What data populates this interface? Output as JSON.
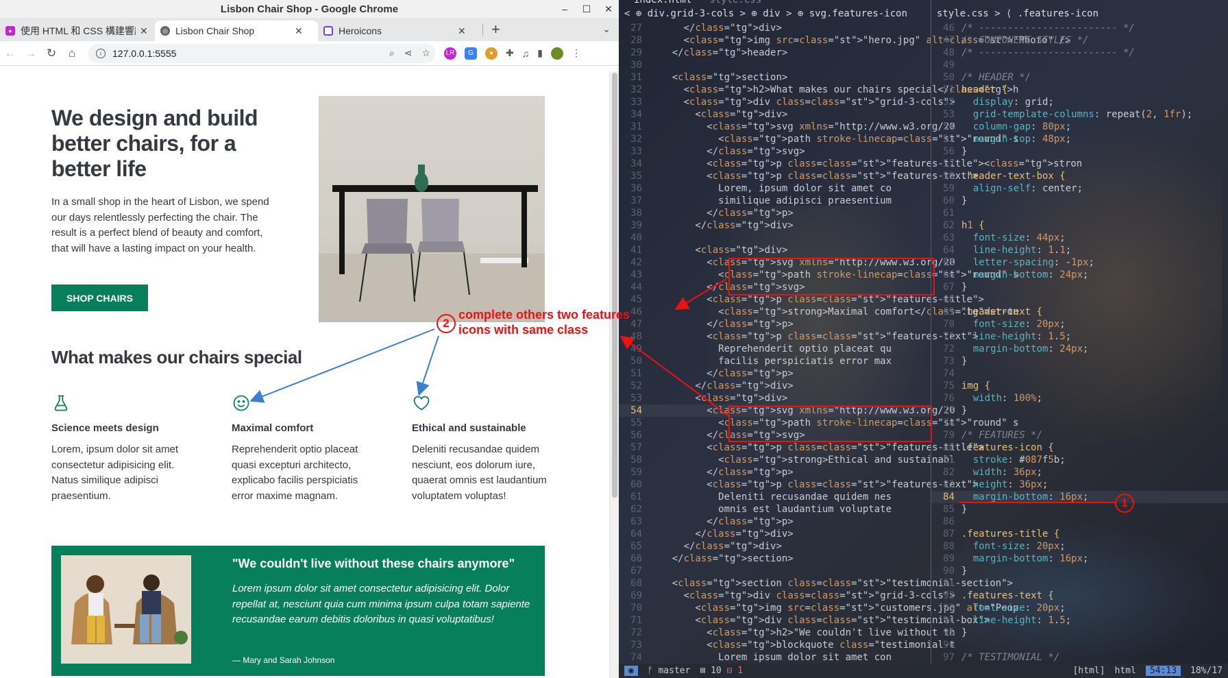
{
  "browser": {
    "window_title": "Lisbon Chair Shop - Google Chrome",
    "tabs": [
      {
        "label": "使用 HTML 和 CSS 構建響應",
        "active": false
      },
      {
        "label": "Lisbon Chair Shop",
        "active": true
      },
      {
        "label": "Heroicons",
        "active": false
      }
    ],
    "url": "127.0.0.1:5555"
  },
  "page": {
    "hero_title": "We design and build better chairs, for a better life",
    "hero_text": "In a small shop in the heart of Lisbon, we spend our days relentlessly perfecting the chair. The result is a perfect blend of beauty and comfort, that will have a lasting impact on your health.",
    "shop_button": "SHOP CHAIRS",
    "section_title": "What makes our chairs special",
    "features": [
      {
        "icon": "beaker-icon",
        "title": "Science meets design",
        "text": "Lorem, ipsum dolor sit amet consectetur adipisicing elit. Natus similique adipisci praesentium."
      },
      {
        "icon": "face-smile-icon",
        "title": "Maximal comfort",
        "text": "Reprehenderit optio placeat quasi excepturi architecto, explicabo facilis perspiciatis error maxime magnam."
      },
      {
        "icon": "heart-icon",
        "title": "Ethical and sustainable",
        "text": "Deleniti recusandae quidem nesciunt, eos dolorum iure, quaerat omnis est laudantium voluptatem voluptas!"
      }
    ],
    "testimonial": {
      "title": "\"We couldn't live without these chairs anymore\"",
      "quote": "Lorem ipsum dolor sit amet consectetur adipisicing elit. Dolor repellat at, nesciunt quia cum minima ipsum culpa totam sapiente recusandae earum debitis doloribus in quasi voluptatibus!",
      "author": "— Mary and Sarah Johnson"
    },
    "accent_color": "#087f5b"
  },
  "editor": {
    "tabs": [
      {
        "label": "index.html",
        "active": true
      },
      {
        "label": "style.css",
        "active": false
      }
    ],
    "left_breadcrumb": "< ⊕ div.grid-3-cols > ⊕ div > ⊕ svg.features-icon",
    "right_breadcrumb": "style.css > ⟨ .features-icon",
    "html_lines": [
      {
        "n": "27",
        "t": "      </div>"
      },
      {
        "n": "28",
        "t": "      <img src=\"hero.jpg\" alt=\"Photo\" />"
      },
      {
        "n": "29",
        "t": "    </header>"
      },
      {
        "n": "30",
        "t": ""
      },
      {
        "n": "31",
        "t": "    <section>"
      },
      {
        "n": "32",
        "t": "      <h2>What makes our chairs special</h"
      },
      {
        "n": "33",
        "t": "      <div class=\"grid-3-cols\">"
      },
      {
        "n": "34",
        "t": "        <div>"
      },
      {
        "n": "31",
        "t": "          <svg xmlns=\"http://www.w3.org/20"
      },
      {
        "n": "32",
        "t": "            <path stroke-linecap=\"round\" s"
      },
      {
        "n": "33",
        "t": "          </svg>"
      },
      {
        "n": "34",
        "t": "          <p class=\"features-title\"><stron"
      },
      {
        "n": "35",
        "t": "          <p class=\"features-text\">"
      },
      {
        "n": "36",
        "t": "            Lorem, ipsum dolor sit amet co"
      },
      {
        "n": "37",
        "t": "            similique adipisci praesentium"
      },
      {
        "n": "38",
        "t": "          </p>"
      },
      {
        "n": "39",
        "t": "        </div>"
      },
      {
        "n": "40",
        "t": ""
      },
      {
        "n": "41",
        "t": "        <div>"
      },
      {
        "n": "42",
        "t": "          <svg xmlns=\"http://www.w3.org/20"
      },
      {
        "n": "43",
        "t": "            <path stroke-linecap=\"round\" s"
      },
      {
        "n": "44",
        "t": "          </svg>"
      },
      {
        "n": "45",
        "t": "          <p class=\"features-title\">"
      },
      {
        "n": "46",
        "t": "            <strong>Maximal comfort</stron"
      },
      {
        "n": "47",
        "t": "          </p>"
      },
      {
        "n": "48",
        "t": "          <p class=\"features-text\">"
      },
      {
        "n": "49",
        "t": "            Reprehenderit optio placeat qu"
      },
      {
        "n": "50",
        "t": "            facilis perspiciatis error max"
      },
      {
        "n": "51",
        "t": "          </p>"
      },
      {
        "n": "52",
        "t": "        </div>"
      },
      {
        "n": "53",
        "t": "        <div>"
      },
      {
        "n": "54",
        "t": "          <svg xmlns=\"http://www.w3.org/20"
      },
      {
        "n": "55",
        "t": "            <path stroke-linecap=\"round\" s"
      },
      {
        "n": "56",
        "t": "          </svg>"
      },
      {
        "n": "57",
        "t": "          <p class=\"features-title\">"
      },
      {
        "n": "58",
        "t": "            <strong>Ethical and sustainabl"
      },
      {
        "n": "59",
        "t": "          </p>"
      },
      {
        "n": "60",
        "t": "          <p class=\"features-text\">"
      },
      {
        "n": "61",
        "t": "            Deleniti recusandae quidem nes"
      },
      {
        "n": "62",
        "t": "            omnis est laudantium voluptate"
      },
      {
        "n": "63",
        "t": "          </p>"
      },
      {
        "n": "64",
        "t": "        </div>"
      },
      {
        "n": "65",
        "t": "      </div>"
      },
      {
        "n": "66",
        "t": "    </section>"
      },
      {
        "n": "67",
        "t": ""
      },
      {
        "n": "68",
        "t": "    <section class=\"testimonial-section\">"
      },
      {
        "n": "69",
        "t": "      <div class=\"grid-3-cols\">"
      },
      {
        "n": "70",
        "t": "        <img src=\"customers.jpg\" alt=\"Peop"
      },
      {
        "n": "71",
        "t": "        <div class=\"testimonial-box\">"
      },
      {
        "n": "72",
        "t": "          <h2>\"We couldn't live without th"
      },
      {
        "n": "73",
        "t": "          <blockquote class=\"testimonial-t"
      },
      {
        "n": "74",
        "t": "            Lorem ipsum dolor sit amet con"
      }
    ],
    "css_lines": [
      {
        "n": "46",
        "t": "/* ------------------------ */"
      },
      {
        "n": "47",
        "t": "/* COMPONENT STYLES */"
      },
      {
        "n": "48",
        "t": "/* ------------------------ */"
      },
      {
        "n": "49",
        "t": ""
      },
      {
        "n": "50",
        "t": "/* HEADER */"
      },
      {
        "n": "51",
        "t": "header {"
      },
      {
        "n": "52",
        "t": "  display: grid;"
      },
      {
        "n": "53",
        "t": "  grid-template-columns: repeat(2, 1fr);"
      },
      {
        "n": "54",
        "t": "  column-gap: 80px;"
      },
      {
        "n": "55",
        "t": "  margin-top: 48px;"
      },
      {
        "n": "56",
        "t": "}"
      },
      {
        "n": "57",
        "t": ""
      },
      {
        "n": "58",
        "t": ".header-text-box {"
      },
      {
        "n": "59",
        "t": "  align-self: center;"
      },
      {
        "n": "60",
        "t": "}"
      },
      {
        "n": "61",
        "t": ""
      },
      {
        "n": "62",
        "t": "h1 {"
      },
      {
        "n": "63",
        "t": "  font-size: 44px;"
      },
      {
        "n": "64",
        "t": "  line-height: 1.1;"
      },
      {
        "n": "65",
        "t": "  letter-spacing: -1px;"
      },
      {
        "n": "66",
        "t": "  margin-bottom: 24px;"
      },
      {
        "n": "67",
        "t": "}"
      },
      {
        "n": "68",
        "t": ""
      },
      {
        "n": "69",
        "t": ".header-text {"
      },
      {
        "n": "70",
        "t": "  font-size: 20px;"
      },
      {
        "n": "71",
        "t": "  line-height: 1.5;"
      },
      {
        "n": "72",
        "t": "  margin-bottom: 24px;"
      },
      {
        "n": "73",
        "t": "}"
      },
      {
        "n": "74",
        "t": ""
      },
      {
        "n": "75",
        "t": "img {"
      },
      {
        "n": "76",
        "t": "  width: 100%;"
      },
      {
        "n": "77",
        "t": "}"
      },
      {
        "n": "78",
        "t": ""
      },
      {
        "n": "79",
        "t": "/* FEATURES */"
      },
      {
        "n": "80",
        "t": ".features-icon {"
      },
      {
        "n": "81",
        "t": "  stroke: #087f5b;"
      },
      {
        "n": "82",
        "t": "  width: 36px;"
      },
      {
        "n": "83",
        "t": "  height: 36px;"
      },
      {
        "n": "84",
        "t": "  margin-bottom: 16px;"
      },
      {
        "n": "85",
        "t": "}"
      },
      {
        "n": "86",
        "t": ""
      },
      {
        "n": "87",
        "t": ".features-title {"
      },
      {
        "n": "88",
        "t": "  font-size: 20px;"
      },
      {
        "n": "89",
        "t": "  margin-bottom: 16px;"
      },
      {
        "n": "90",
        "t": "}"
      },
      {
        "n": "91",
        "t": ""
      },
      {
        "n": "92",
        "t": ".features-text {"
      },
      {
        "n": "93",
        "t": "  font-size: 20px;"
      },
      {
        "n": "94",
        "t": "  line-height: 1.5;"
      },
      {
        "n": "95",
        "t": "}"
      },
      {
        "n": "96",
        "t": ""
      },
      {
        "n": "97",
        "t": "/* TESTIMONIAL */"
      }
    ],
    "status": {
      "branch": "master",
      "errors": "10",
      "warnings": "1",
      "filetype": "[html]",
      "lang": "html",
      "position": "54:13",
      "percent": "18%/17"
    }
  },
  "annotations": {
    "step1": "1",
    "step2": "2",
    "step2_text_line1": "complete others two features",
    "step2_text_line2": "icons with same class",
    "annotation_color": "#e11111"
  }
}
